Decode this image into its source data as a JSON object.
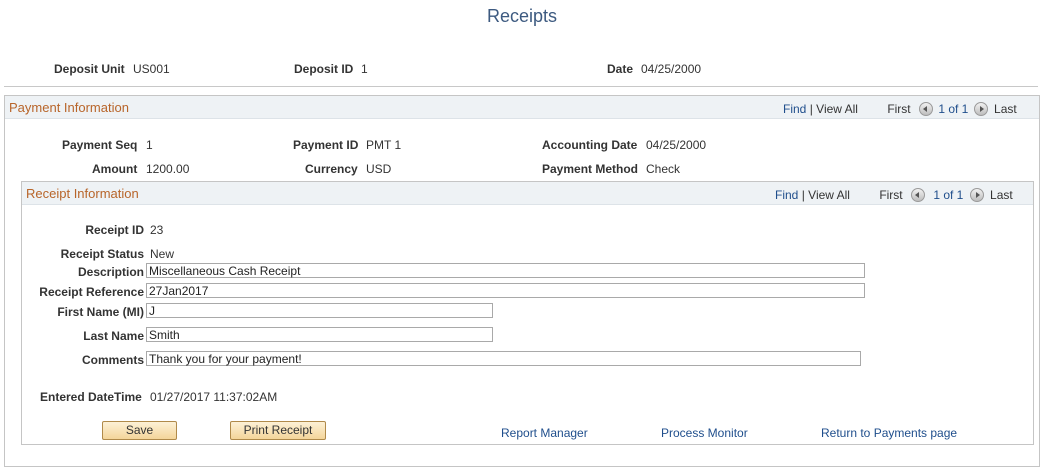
{
  "page": {
    "title": "Receipts"
  },
  "header": {
    "deposit_unit_label": "Deposit Unit",
    "deposit_unit": "US001",
    "deposit_id_label": "Deposit ID",
    "deposit_id": "1",
    "date_label": "Date",
    "date": "04/25/2000"
  },
  "payment_info": {
    "title": "Payment Information",
    "nav": {
      "find": "Find",
      "sep": "|",
      "view_all": "View All",
      "first": "First",
      "range": "1 of 1",
      "last": "Last"
    },
    "payment_seq_label": "Payment Seq",
    "payment_seq": "1",
    "payment_id_label": "Payment ID",
    "payment_id": "PMT 1",
    "accounting_date_label": "Accounting Date",
    "accounting_date": "04/25/2000",
    "amount_label": "Amount",
    "amount": "1200.00",
    "currency_label": "Currency",
    "currency": "USD",
    "payment_method_label": "Payment Method",
    "payment_method": "Check"
  },
  "receipt_info": {
    "title": "Receipt Information",
    "nav": {
      "find": "Find",
      "sep": "|",
      "view_all": "View All",
      "first": "First",
      "range": "1 of 1",
      "last": "Last"
    },
    "receipt_id_label": "Receipt ID",
    "receipt_id": "23",
    "receipt_status_label": "Receipt Status",
    "receipt_status": "New",
    "description_label": "Description",
    "description": "Miscellaneous Cash Receipt",
    "reference_label": "Receipt Reference",
    "reference": "27Jan2017",
    "first_name_label": "First Name (MI)",
    "first_name": "J",
    "last_name_label": "Last Name",
    "last_name": "Smith",
    "comments_label": "Comments",
    "comments": "Thank you for your payment!",
    "entered_label": "Entered DateTime",
    "entered": "01/27/2017 11:37:02AM"
  },
  "actions": {
    "save": "Save",
    "print_receipt": "Print Receipt",
    "report_manager": "Report Manager",
    "process_monitor": "Process Monitor",
    "return_payments": "Return to Payments page"
  }
}
